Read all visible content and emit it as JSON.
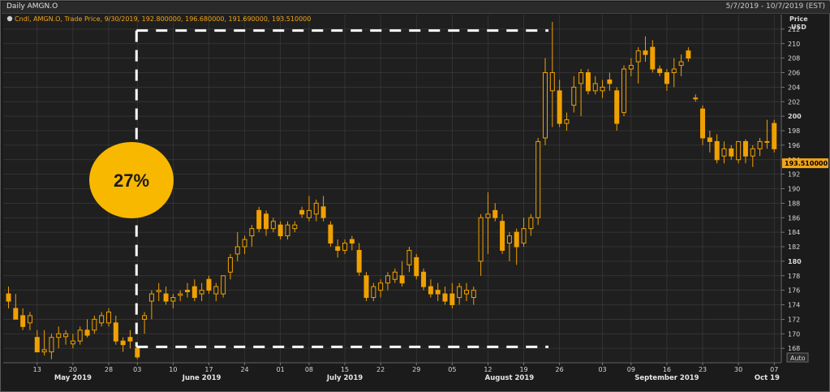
{
  "window": {
    "title": "Daily AMGN.O",
    "date_range": "5/7/2019 - 10/7/2019 (EST)"
  },
  "legend": {
    "text": "Cndl, AMGN.O, Trade Price, 9/30/2019, 192.800000, 196.680000, 191.690000, 193.510000"
  },
  "axis": {
    "price_label": "Price",
    "currency_label": "USD",
    "auto_button": "Auto"
  },
  "annotation": {
    "label": "27%",
    "badge_color": "#f9b800"
  },
  "last_price": {
    "label": "193.510000",
    "value": 193.51
  },
  "colors": {
    "up": "#f0a000",
    "down": "#f0a000",
    "grid": "#3a3a3a",
    "background": "#1b1b1b"
  },
  "chart_data": {
    "type": "candlestick",
    "ylim": [
      166,
      214
    ],
    "y_ticks": [
      168,
      170,
      172,
      174,
      176,
      178,
      180,
      182,
      184,
      186,
      188,
      190,
      192,
      194,
      196,
      198,
      200,
      202,
      204,
      206,
      208,
      210,
      212
    ],
    "y_tick_bold": [
      180,
      200
    ],
    "x_day_ticks": [
      {
        "label": "13",
        "date": "2019-05-13"
      },
      {
        "label": "20",
        "date": "2019-05-20"
      },
      {
        "label": "28",
        "date": "2019-05-28"
      },
      {
        "label": "03",
        "date": "2019-06-03"
      },
      {
        "label": "10",
        "date": "2019-06-10"
      },
      {
        "label": "17",
        "date": "2019-06-17"
      },
      {
        "label": "24",
        "date": "2019-06-24"
      },
      {
        "label": "01",
        "date": "2019-07-01"
      },
      {
        "label": "08",
        "date": "2019-07-08"
      },
      {
        "label": "15",
        "date": "2019-07-15"
      },
      {
        "label": "22",
        "date": "2019-07-22"
      },
      {
        "label": "29",
        "date": "2019-07-29"
      },
      {
        "label": "05",
        "date": "2019-08-05"
      },
      {
        "label": "12",
        "date": "2019-08-12"
      },
      {
        "label": "19",
        "date": "2019-08-19"
      },
      {
        "label": "26",
        "date": "2019-08-26"
      },
      {
        "label": "03",
        "date": "2019-09-03"
      },
      {
        "label": "09",
        "date": "2019-09-09"
      },
      {
        "label": "16",
        "date": "2019-09-16"
      },
      {
        "label": "23",
        "date": "2019-09-23"
      },
      {
        "label": "30",
        "date": "2019-09-30"
      },
      {
        "label": "07",
        "date": "2019-10-07"
      }
    ],
    "x_months": [
      {
        "label": "May 2019",
        "date": "2019-05-20"
      },
      {
        "label": "June 2019",
        "date": "2019-06-14"
      },
      {
        "label": "July 2019",
        "date": "2019-07-15"
      },
      {
        "label": "August 2019",
        "date": "2019-08-15"
      },
      {
        "label": "September 2019",
        "date": "2019-09-16"
      },
      {
        "label": "Oct 19",
        "date": "2019-10-04"
      }
    ],
    "candles": [
      {
        "d": "2019-05-07",
        "o": 175.5,
        "h": 176.5,
        "l": 173.5,
        "c": 174.5
      },
      {
        "d": "2019-05-08",
        "o": 173.5,
        "h": 175.5,
        "l": 172.5,
        "c": 172.0
      },
      {
        "d": "2019-05-09",
        "o": 172.5,
        "h": 173.5,
        "l": 170.5,
        "c": 171.0
      },
      {
        "d": "2019-05-10",
        "o": 171.5,
        "h": 173.0,
        "l": 170.5,
        "c": 172.5
      },
      {
        "d": "2019-05-13",
        "o": 169.5,
        "h": 170.5,
        "l": 167.5,
        "c": 167.5
      },
      {
        "d": "2019-05-14",
        "o": 167.5,
        "h": 170.5,
        "l": 167.0,
        "c": 167.8
      },
      {
        "d": "2019-05-15",
        "o": 167.5,
        "h": 170.0,
        "l": 166.5,
        "c": 169.5
      },
      {
        "d": "2019-05-16",
        "o": 169.5,
        "h": 171.0,
        "l": 168.0,
        "c": 170.0
      },
      {
        "d": "2019-05-17",
        "o": 169.6,
        "h": 170.5,
        "l": 168.5,
        "c": 170.0
      },
      {
        "d": "2019-05-20",
        "o": 168.6,
        "h": 170.0,
        "l": 168.0,
        "c": 169.0
      },
      {
        "d": "2019-05-21",
        "o": 169.0,
        "h": 171.0,
        "l": 168.5,
        "c": 170.5
      },
      {
        "d": "2019-05-22",
        "o": 170.5,
        "h": 172.0,
        "l": 169.5,
        "c": 169.8
      },
      {
        "d": "2019-05-23",
        "o": 170.5,
        "h": 172.5,
        "l": 170.0,
        "c": 172.0
      },
      {
        "d": "2019-05-24",
        "o": 171.5,
        "h": 173.0,
        "l": 171.0,
        "c": 172.5
      },
      {
        "d": "2019-05-28",
        "o": 171.5,
        "h": 173.5,
        "l": 171.0,
        "c": 173.0
      },
      {
        "d": "2019-05-29",
        "o": 171.5,
        "h": 172.5,
        "l": 168.5,
        "c": 169.0
      },
      {
        "d": "2019-05-30",
        "o": 169.0,
        "h": 169.5,
        "l": 167.5,
        "c": 168.5
      },
      {
        "d": "2019-05-31",
        "o": 169.5,
        "h": 170.5,
        "l": 168.0,
        "c": 169.0
      },
      {
        "d": "2019-06-03",
        "o": 168.0,
        "h": 168.5,
        "l": 166.5,
        "c": 166.8
      },
      {
        "d": "2019-06-04",
        "o": 172.0,
        "h": 173.0,
        "l": 170.0,
        "c": 172.5
      },
      {
        "d": "2019-06-05",
        "o": 174.5,
        "h": 176.0,
        "l": 172.0,
        "c": 175.5
      },
      {
        "d": "2019-06-06",
        "o": 175.8,
        "h": 177.0,
        "l": 174.5,
        "c": 176.0
      },
      {
        "d": "2019-06-07",
        "o": 175.5,
        "h": 176.5,
        "l": 174.0,
        "c": 174.5
      },
      {
        "d": "2019-06-10",
        "o": 174.5,
        "h": 175.5,
        "l": 173.5,
        "c": 175.0
      },
      {
        "d": "2019-06-11",
        "o": 175.3,
        "h": 176.0,
        "l": 174.5,
        "c": 175.5
      },
      {
        "d": "2019-06-12",
        "o": 176.0,
        "h": 177.0,
        "l": 175.0,
        "c": 175.8
      },
      {
        "d": "2019-06-13",
        "o": 176.5,
        "h": 177.5,
        "l": 174.5,
        "c": 175.0
      },
      {
        "d": "2019-06-14",
        "o": 175.5,
        "h": 177.0,
        "l": 174.5,
        "c": 176.0
      },
      {
        "d": "2019-06-17",
        "o": 177.5,
        "h": 178.0,
        "l": 175.5,
        "c": 176.0
      },
      {
        "d": "2019-06-18",
        "o": 175.5,
        "h": 177.0,
        "l": 174.5,
        "c": 176.5
      },
      {
        "d": "2019-06-19",
        "o": 175.5,
        "h": 178.0,
        "l": 175.0,
        "c": 178.0
      },
      {
        "d": "2019-06-20",
        "o": 178.5,
        "h": 181.0,
        "l": 177.5,
        "c": 180.5
      },
      {
        "d": "2019-06-21",
        "o": 181.0,
        "h": 184.0,
        "l": 180.0,
        "c": 182.0
      },
      {
        "d": "2019-06-24",
        "o": 182.0,
        "h": 183.5,
        "l": 181.0,
        "c": 183.0
      },
      {
        "d": "2019-06-25",
        "o": 183.5,
        "h": 185.0,
        "l": 182.0,
        "c": 184.5
      },
      {
        "d": "2019-06-26",
        "o": 187.0,
        "h": 187.5,
        "l": 184.0,
        "c": 184.5
      },
      {
        "d": "2019-06-27",
        "o": 186.5,
        "h": 187.0,
        "l": 183.5,
        "c": 184.5
      },
      {
        "d": "2019-06-28",
        "o": 184.5,
        "h": 186.0,
        "l": 184.0,
        "c": 185.5
      },
      {
        "d": "2019-07-01",
        "o": 185.0,
        "h": 185.5,
        "l": 183.0,
        "c": 183.5
      },
      {
        "d": "2019-07-02",
        "o": 183.5,
        "h": 185.5,
        "l": 183.0,
        "c": 185.0
      },
      {
        "d": "2019-07-03",
        "o": 184.5,
        "h": 185.5,
        "l": 184.0,
        "c": 185.0
      },
      {
        "d": "2019-07-05",
        "o": 187.0,
        "h": 187.5,
        "l": 186.0,
        "c": 186.5
      },
      {
        "d": "2019-07-08",
        "o": 186.0,
        "h": 189.0,
        "l": 185.5,
        "c": 187.0
      },
      {
        "d": "2019-07-09",
        "o": 186.5,
        "h": 188.5,
        "l": 185.5,
        "c": 188.0
      },
      {
        "d": "2019-07-10",
        "o": 187.5,
        "h": 189.0,
        "l": 185.5,
        "c": 186.0
      },
      {
        "d": "2019-07-11",
        "o": 185.0,
        "h": 185.5,
        "l": 182.0,
        "c": 182.5
      },
      {
        "d": "2019-07-12",
        "o": 182.0,
        "h": 183.0,
        "l": 180.5,
        "c": 181.5
      },
      {
        "d": "2019-07-15",
        "o": 181.5,
        "h": 183.0,
        "l": 181.0,
        "c": 182.5
      },
      {
        "d": "2019-07-16",
        "o": 183.0,
        "h": 183.5,
        "l": 181.5,
        "c": 182.5
      },
      {
        "d": "2019-07-17",
        "o": 181.5,
        "h": 182.5,
        "l": 178.0,
        "c": 178.5
      },
      {
        "d": "2019-07-18",
        "o": 178.0,
        "h": 178.5,
        "l": 174.5,
        "c": 175.0
      },
      {
        "d": "2019-07-19",
        "o": 175.0,
        "h": 177.0,
        "l": 174.5,
        "c": 176.5
      },
      {
        "d": "2019-07-22",
        "o": 176.0,
        "h": 177.5,
        "l": 175.0,
        "c": 177.0
      },
      {
        "d": "2019-07-23",
        "o": 177.0,
        "h": 178.5,
        "l": 176.0,
        "c": 178.0
      },
      {
        "d": "2019-07-24",
        "o": 177.5,
        "h": 179.0,
        "l": 177.0,
        "c": 178.5
      },
      {
        "d": "2019-07-25",
        "o": 178.0,
        "h": 180.0,
        "l": 176.5,
        "c": 177.0
      },
      {
        "d": "2019-07-26",
        "o": 179.5,
        "h": 182.0,
        "l": 178.5,
        "c": 181.5
      },
      {
        "d": "2019-07-29",
        "o": 180.5,
        "h": 181.0,
        "l": 177.5,
        "c": 178.0
      },
      {
        "d": "2019-07-30",
        "o": 178.5,
        "h": 179.0,
        "l": 176.0,
        "c": 176.5
      },
      {
        "d": "2019-07-31",
        "o": 176.5,
        "h": 177.5,
        "l": 175.0,
        "c": 175.5
      },
      {
        "d": "2019-08-01",
        "o": 176.0,
        "h": 177.0,
        "l": 174.5,
        "c": 175.5
      },
      {
        "d": "2019-08-02",
        "o": 175.5,
        "h": 176.5,
        "l": 174.0,
        "c": 174.5
      },
      {
        "d": "2019-08-05",
        "o": 175.5,
        "h": 177.0,
        "l": 173.5,
        "c": 174.0
      },
      {
        "d": "2019-08-06",
        "o": 175.0,
        "h": 177.0,
        "l": 174.0,
        "c": 176.5
      },
      {
        "d": "2019-08-07",
        "o": 175.5,
        "h": 177.0,
        "l": 174.5,
        "c": 176.0
      },
      {
        "d": "2019-08-08",
        "o": 175.0,
        "h": 176.5,
        "l": 174.0,
        "c": 176.0
      },
      {
        "d": "2019-08-09",
        "o": 180.0,
        "h": 186.5,
        "l": 178.0,
        "c": 186.0
      },
      {
        "d": "2019-08-12",
        "o": 186.0,
        "h": 189.5,
        "l": 181.0,
        "c": 186.5
      },
      {
        "d": "2019-08-13",
        "o": 187.0,
        "h": 188.0,
        "l": 185.5,
        "c": 186.0
      },
      {
        "d": "2019-08-14",
        "o": 185.5,
        "h": 186.5,
        "l": 181.0,
        "c": 181.5
      },
      {
        "d": "2019-08-15",
        "o": 182.5,
        "h": 184.0,
        "l": 180.0,
        "c": 183.5
      },
      {
        "d": "2019-08-16",
        "o": 184.0,
        "h": 184.5,
        "l": 179.5,
        "c": 182.0
      },
      {
        "d": "2019-08-19",
        "o": 182.5,
        "h": 186.0,
        "l": 182.0,
        "c": 184.5
      },
      {
        "d": "2019-08-20",
        "o": 184.5,
        "h": 186.5,
        "l": 183.5,
        "c": 186.0
      },
      {
        "d": "2019-08-21",
        "o": 186.0,
        "h": 197.0,
        "l": 185.0,
        "c": 196.5
      },
      {
        "d": "2019-08-22",
        "o": 197.0,
        "h": 208.0,
        "l": 196.0,
        "c": 206.0
      },
      {
        "d": "2019-08-23",
        "o": 203.5,
        "h": 213.0,
        "l": 198.5,
        "c": 206.0
      },
      {
        "d": "2019-08-26",
        "o": 203.5,
        "h": 205.0,
        "l": 198.5,
        "c": 199.0
      },
      {
        "d": "2019-08-27",
        "o": 199.0,
        "h": 200.5,
        "l": 198.0,
        "c": 199.5
      },
      {
        "d": "2019-08-28",
        "o": 201.5,
        "h": 205.5,
        "l": 200.5,
        "c": 204.0
      },
      {
        "d": "2019-08-29",
        "o": 204.5,
        "h": 206.5,
        "l": 200.0,
        "c": 206.0
      },
      {
        "d": "2019-08-30",
        "o": 206.0,
        "h": 206.5,
        "l": 203.0,
        "c": 203.5
      },
      {
        "d": "2019-09-02",
        "o": 203.5,
        "h": 205.5,
        "l": 203.0,
        "c": 204.5
      },
      {
        "d": "2019-09-03",
        "o": 203.5,
        "h": 205.0,
        "l": 202.5,
        "c": 204.0
      },
      {
        "d": "2019-09-04",
        "o": 205.0,
        "h": 206.0,
        "l": 203.5,
        "c": 204.5
      },
      {
        "d": "2019-09-05",
        "o": 203.5,
        "h": 204.0,
        "l": 198.0,
        "c": 199.0
      },
      {
        "d": "2019-09-06",
        "o": 200.5,
        "h": 207.0,
        "l": 200.0,
        "c": 206.5
      },
      {
        "d": "2019-09-09",
        "o": 206.5,
        "h": 208.0,
        "l": 205.5,
        "c": 207.0
      },
      {
        "d": "2019-09-10",
        "o": 207.5,
        "h": 209.5,
        "l": 204.5,
        "c": 209.0
      },
      {
        "d": "2019-09-11",
        "o": 209.0,
        "h": 211.0,
        "l": 207.5,
        "c": 208.5
      },
      {
        "d": "2019-09-12",
        "o": 209.5,
        "h": 210.5,
        "l": 206.0,
        "c": 206.5
      },
      {
        "d": "2019-09-13",
        "o": 206.5,
        "h": 207.0,
        "l": 205.5,
        "c": 206.0
      },
      {
        "d": "2019-09-16",
        "o": 206.0,
        "h": 206.5,
        "l": 203.5,
        "c": 204.5
      },
      {
        "d": "2019-09-17",
        "o": 206.0,
        "h": 208.0,
        "l": 204.0,
        "c": 206.5
      },
      {
        "d": "2019-09-18",
        "o": 207.0,
        "h": 208.5,
        "l": 205.5,
        "c": 207.5
      },
      {
        "d": "2019-09-19",
        "o": 209.0,
        "h": 209.5,
        "l": 207.5,
        "c": 208.0
      },
      {
        "d": "2019-09-20",
        "o": 202.5,
        "h": 203.0,
        "l": 202.0,
        "c": 202.5
      },
      {
        "d": "2019-09-23",
        "o": 201.0,
        "h": 201.5,
        "l": 196.0,
        "c": 197.0
      },
      {
        "d": "2019-09-24",
        "o": 197.0,
        "h": 198.0,
        "l": 195.0,
        "c": 196.5
      },
      {
        "d": "2019-09-25",
        "o": 196.5,
        "h": 197.5,
        "l": 193.5,
        "c": 194.0
      },
      {
        "d": "2019-09-26",
        "o": 194.5,
        "h": 196.5,
        "l": 193.5,
        "c": 195.5
      },
      {
        "d": "2019-09-27",
        "o": 195.5,
        "h": 196.0,
        "l": 194.0,
        "c": 194.5
      },
      {
        "d": "2019-09-30",
        "o": 194.0,
        "h": 196.5,
        "l": 193.5,
        "c": 196.5
      },
      {
        "d": "2019-10-01",
        "o": 196.5,
        "h": 196.8,
        "l": 193.5,
        "c": 194.5
      },
      {
        "d": "2019-10-02",
        "o": 194.5,
        "h": 196.0,
        "l": 193.0,
        "c": 195.5
      },
      {
        "d": "2019-10-03",
        "o": 195.5,
        "h": 197.0,
        "l": 194.5,
        "c": 196.5
      },
      {
        "d": "2019-10-04",
        "o": 196.5,
        "h": 199.5,
        "l": 195.5,
        "c": 196.5
      },
      {
        "d": "2019-10-07",
        "o": 199.0,
        "h": 199.5,
        "l": 195.0,
        "c": 195.5
      }
    ],
    "dashed_box": {
      "x_start": "2019-06-03",
      "x_end": "2019-08-22",
      "y_low": 168.2,
      "y_high": 211.8,
      "note": "white dashed bracket marking the low-to-high move"
    }
  }
}
